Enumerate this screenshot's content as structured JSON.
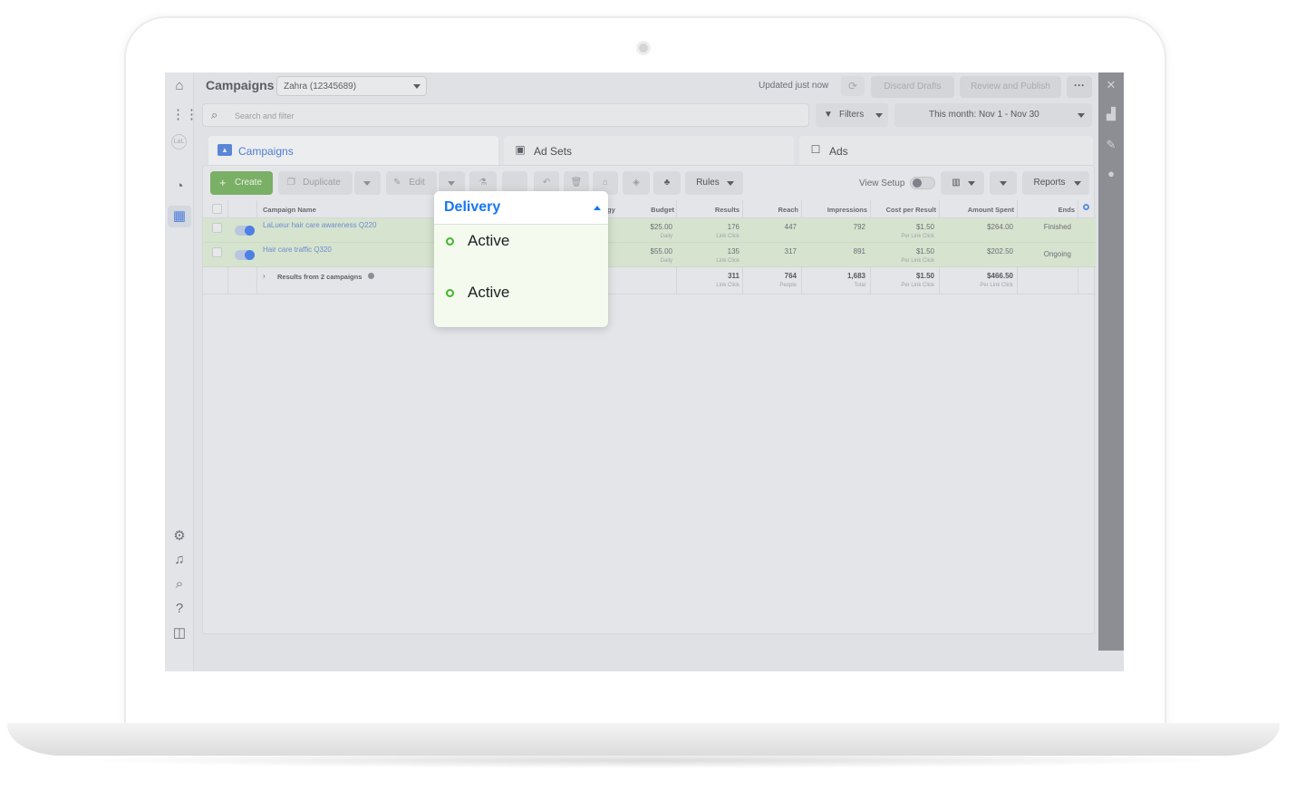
{
  "header": {
    "title": "Campaigns",
    "account": "Zahra (12345689)",
    "updated": "Updated just now",
    "discard_drafts": "Discard Drafts",
    "review_publish": "Review and Publish",
    "more": "···"
  },
  "search": {
    "placeholder": "Search and filter"
  },
  "filters": {
    "label": "Filters",
    "date_range": "This month: Nov 1 - Nov 30"
  },
  "tabs": [
    {
      "label": "Campaigns"
    },
    {
      "label": "Ad Sets"
    },
    {
      "label": "Ads"
    }
  ],
  "toolbar": {
    "create": "Create",
    "duplicate": "Duplicate",
    "edit": "Edit",
    "rules": "Rules",
    "view_setup": "View Setup",
    "reports": "Reports"
  },
  "table": {
    "columns": {
      "name": "Campaign Name",
      "strategy_fragment": "gy",
      "budget": "Budget",
      "results": "Results",
      "reach": "Reach",
      "impressions": "Impressions",
      "cost_per_result": "Cost per Result",
      "amount_spent": "Amount Spent",
      "ends": "Ends"
    },
    "rows": [
      {
        "name": "LaLueur hair care awareness Q220",
        "strategy_fragment": "t",
        "budget": "$25.00",
        "budget_sub": "Daily",
        "results": "176",
        "results_sub": "Link Click",
        "reach": "447",
        "impressions": "792",
        "cost": "$1.50",
        "cost_sub": "Per Link Click",
        "spent": "$264.00",
        "ends": "Finished"
      },
      {
        "name": "Hair care traffic Q320",
        "strategy_fragment": "t",
        "budget": "$55.00",
        "budget_sub": "Daily",
        "results": "135",
        "results_sub": "Link Click",
        "reach": "317",
        "impressions": "891",
        "cost": "$1.50",
        "cost_sub": "Per Link Click",
        "spent": "$202.50",
        "ends": "Ongoing"
      }
    ],
    "summary": {
      "label": "Results from 2 campaigns",
      "results": "311",
      "results_sub": "Link Click",
      "reach": "764",
      "reach_sub": "People",
      "impressions": "1,683",
      "impressions_sub": "Total",
      "cost": "$1.50",
      "cost_sub": "Per Link Click",
      "spent": "$466.50",
      "spent_sub": "Per Link Click"
    }
  },
  "delivery_popup": {
    "title": "Delivery",
    "items": [
      {
        "label": "Active"
      },
      {
        "label": "Active"
      }
    ]
  },
  "colors": {
    "accent": "#1877f2",
    "active_status": "#42b72a",
    "create_green": "#7aaf66"
  },
  "icons": {
    "rail": [
      "home-icon",
      "apps-grid-icon",
      "account-logo-icon",
      "dashboard-icon",
      "table-icon",
      "settings-icon",
      "bell-icon",
      "search-icon",
      "help-icon",
      "panel-icon"
    ]
  }
}
